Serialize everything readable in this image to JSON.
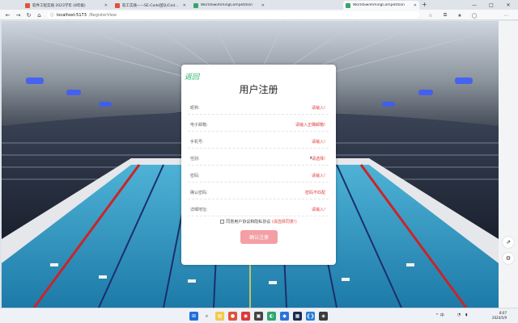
{
  "browser": {
    "tabs": [
      {
        "title": "软件工程实践 2023学年 (8年级)",
        "color": "#e0523a"
      },
      {
        "title": "软工实践——SE-Code团队/Codeb...",
        "color": "#e0523a"
      },
      {
        "title": "WorldSwimmingCompetition",
        "color": "#3aa56b"
      },
      {
        "title": "WorldSwimmingCompetition",
        "color": "#3aa56b"
      }
    ],
    "new_tab": "+",
    "window_controls": {
      "minimize": "—",
      "maximize": "□",
      "close": "✕"
    },
    "nav": {
      "back": "←",
      "forward": "→",
      "reload": "↻",
      "home": "⌂"
    },
    "url_host": "localhost:5173",
    "url_path": "/RegisterView",
    "toolbar_icons": [
      "star-icon",
      "extensions-icon",
      "favorites-icon",
      "profile-icon",
      "more-icon"
    ]
  },
  "sidebar": {
    "icons": [
      "share-icon",
      "settings-icon"
    ]
  },
  "form": {
    "back_label": "返回",
    "title": "用户注册",
    "fields": [
      {
        "label": "昵称:",
        "error": "请输入!"
      },
      {
        "label": "电子邮箱:",
        "error": "请输入正确邮箱!"
      },
      {
        "label": "手机号:",
        "error": "请输入!"
      },
      {
        "label": "性别:",
        "error": "请选择!"
      },
      {
        "label": "密码:",
        "error": "请输入!"
      },
      {
        "label": "确认密码:",
        "error": "密码不匹配"
      },
      {
        "label": "详细地址:",
        "error": "请输入!"
      }
    ],
    "agreement": "同意用户协议和隐私协议",
    "agreement_warning": "(请选择同意!)",
    "submit_label": "确认注册"
  },
  "taskbar": {
    "time": "8:07",
    "date": "2024/5/9",
    "tray": "^ 中"
  }
}
